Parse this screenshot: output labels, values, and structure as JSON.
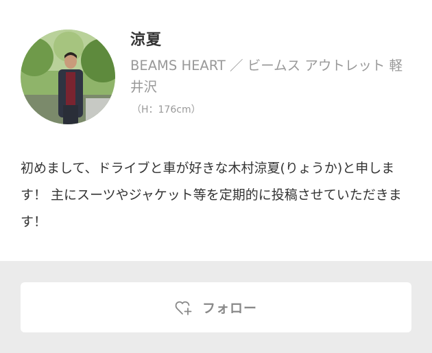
{
  "profile": {
    "name": "涼夏",
    "shop": "BEAMS HEART ／ ビームス アウトレット 軽井沢",
    "height": "（H：176cm）",
    "bio": "初めまして、ドライブと車が好きな木村涼夏(りょうか)と申します！ 主にスーツやジャケット等を定期的に投稿させていただきます！",
    "avatar_icon": "staff-photo"
  },
  "actions": {
    "follow_label": "フォロー",
    "follow_icon": "heart-plus-icon"
  },
  "colors": {
    "background": "#ffffff",
    "panel": "#ebebeb",
    "text": "#333333",
    "muted": "#999999",
    "button_text": "#888888"
  }
}
